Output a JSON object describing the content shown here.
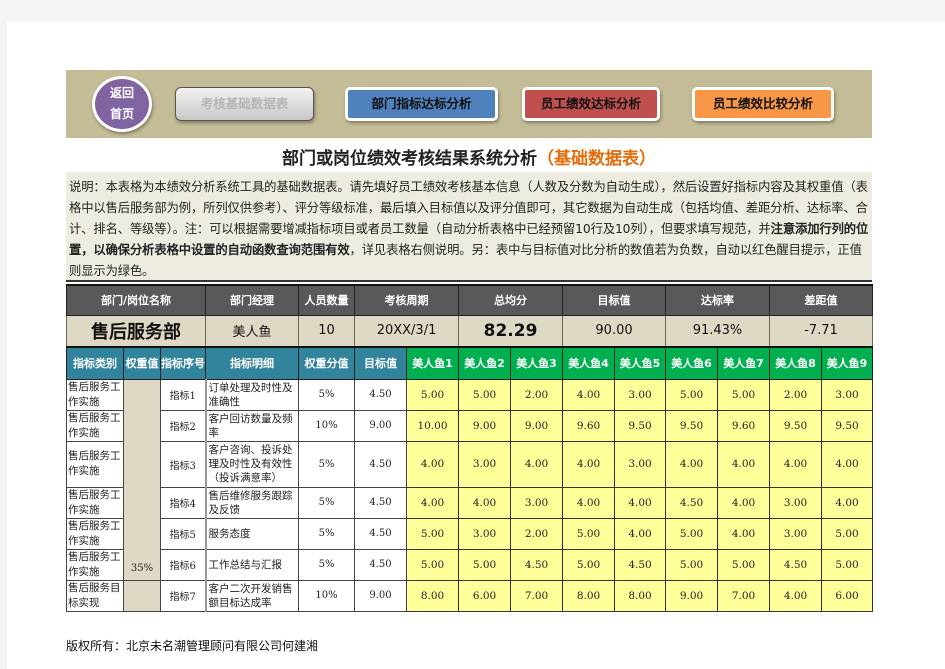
{
  "nav": {
    "home_label_line1": "返回",
    "home_label_line2": "首页",
    "buttons": [
      {
        "label": "考核基础数据表",
        "state": "disabled",
        "color": "#c8c8c8"
      },
      {
        "label": "部门指标达标分析",
        "state": "normal",
        "color": "#4f81bd"
      },
      {
        "label": "员工绩效达标分析",
        "state": "normal",
        "color": "#c0504d"
      },
      {
        "label": "员工绩效比较分析",
        "state": "normal",
        "color": "#f79646"
      }
    ]
  },
  "title": {
    "main": "部门或岗位绩效考核结果系统分析",
    "sub": "（基础数据表）",
    "sub_color": "#e46c0a"
  },
  "description": {
    "part1": "说明：本表格为本绩效分析系统工具的基础数据表。请先填好员工绩效考核基本信息（人数及分数为自动生成），然后设置好指标内容及其权重值（表格中以售后服务部为例，所列仅供参考）、评分等级标准，最后填入目标值以及评分值即可，其它数据为自动生成（包括均值、差距分析、达标率、合计、排名、等级等）。注：可以根据需要增减指标项目或者员工数量（自动分析表格中已经预留10行及10列），但要求填写规范，并",
    "bold": "注意添加行列的位置，以确保分析表格中设置的自动函数查询范围有效",
    "part2": "，详见表格右侧说明。另：表中与目标值对比分析的数值若为负数，自动以红色醒目提示，正值则显示为绿色。"
  },
  "summary": {
    "headers": [
      "部门/岗位名称",
      "部门经理",
      "人员数量",
      "考核周期",
      "总均分",
      "目标值",
      "达标率",
      "差距值"
    ],
    "values": {
      "dept": "售后服务部",
      "manager": "美人鱼",
      "headcount": "10",
      "period": "20XX/3/1",
      "avg_score": "82.29",
      "target": "90.00",
      "rate": "91.43%",
      "gap": "-7.71"
    }
  },
  "detail_table": {
    "headers": [
      "指标类别",
      "权重值",
      "指标序号",
      "指标明细",
      "权重分值",
      "目标值"
    ],
    "employees": [
      "美人鱼1",
      "美人鱼2",
      "美人鱼3",
      "美人鱼4",
      "美人鱼5",
      "美人鱼6",
      "美人鱼7",
      "美人鱼8",
      "美人鱼9"
    ],
    "group_weight": "35%",
    "rows": [
      {
        "category": "售后服务工作实施",
        "index": "指标1",
        "detail": "订单处理及时性及准确性",
        "weight": "5%",
        "target": "4.50",
        "scores": [
          "5.00",
          "5.00",
          "2.00",
          "4.00",
          "3.00",
          "5.00",
          "5.00",
          "2.00",
          "3.00"
        ]
      },
      {
        "category": "售后服务工作实施",
        "index": "指标2",
        "detail": "客户回访数量及频率",
        "weight": "10%",
        "target": "9.00",
        "scores": [
          "10.00",
          "9.00",
          "9.00",
          "9.60",
          "9.50",
          "9.50",
          "9.60",
          "9.50",
          "9.50"
        ]
      },
      {
        "category": "售后服务工作实施",
        "index": "指标3",
        "detail": "客户咨询、投诉处理及时性及有效性（投诉满意率）",
        "weight": "5%",
        "target": "4.50",
        "scores": [
          "4.00",
          "3.00",
          "4.00",
          "4.00",
          "3.00",
          "4.00",
          "4.00",
          "4.00",
          "4.00"
        ]
      },
      {
        "category": "售后服务工作实施",
        "index": "指标4",
        "detail": "售后维修服务跟踪及反馈",
        "weight": "5%",
        "target": "4.50",
        "scores": [
          "4.00",
          "4.00",
          "3.00",
          "4.00",
          "4.00",
          "4.50",
          "4.00",
          "3.00",
          "4.00"
        ]
      },
      {
        "category": "售后服务工作实施",
        "index": "指标5",
        "detail": "服务态度",
        "weight": "5%",
        "target": "4.50",
        "scores": [
          "5.00",
          "3.00",
          "2.00",
          "5.00",
          "4.00",
          "5.00",
          "4.00",
          "3.00",
          "5.00"
        ]
      },
      {
        "category": "售后服务工作实施",
        "index": "指标6",
        "detail": "工作总结与汇报",
        "weight": "5%",
        "target": "4.50",
        "scores": [
          "5.00",
          "5.00",
          "4.50",
          "5.00",
          "4.50",
          "5.00",
          "5.00",
          "4.50",
          "5.00"
        ]
      },
      {
        "category": "售后服务目标实现",
        "index": "指标7",
        "detail": "客户二次开发销售额目标达成率",
        "weight": "10%",
        "target": "9.00",
        "scores": [
          "8.00",
          "6.00",
          "7.00",
          "8.00",
          "8.00",
          "9.00",
          "7.00",
          "4.00",
          "6.00"
        ]
      }
    ]
  },
  "footer": "版权所有：北京未名潮管理顾问有限公司何建湘"
}
